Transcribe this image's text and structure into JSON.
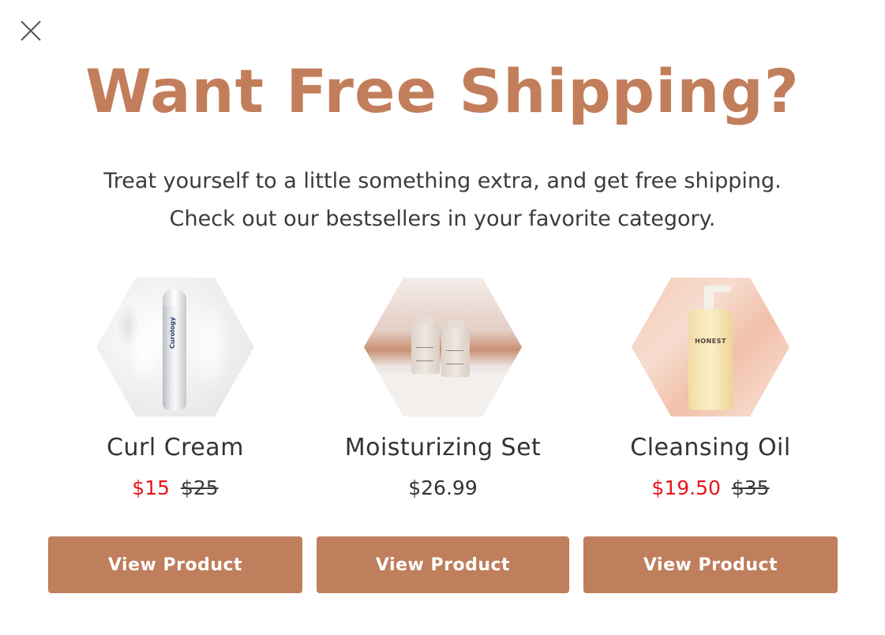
{
  "modal": {
    "close_icon": "close-icon",
    "headline": "Want Free Shipping?",
    "subtext_line1": "Treat yourself to a little something extra, and get free shipping.",
    "subtext_line2": "Check out our bestsellers in your favorite category."
  },
  "colors": {
    "accent": "#c27e5b",
    "button": "#bf7e5c",
    "sale_price": "#e8141b",
    "text": "#3b3b3b"
  },
  "products": [
    {
      "name": "Curl Cream",
      "image_label": "Curology",
      "sale_price": "$15",
      "original_price": "$25",
      "button_label": "View Product"
    },
    {
      "name": "Moisturizing Set",
      "price": "$26.99",
      "button_label": "View Product"
    },
    {
      "name": "Cleansing Oil",
      "image_label": "HONEST",
      "sale_price": "$19.50",
      "original_price": "$35",
      "button_label": "View Product"
    }
  ]
}
